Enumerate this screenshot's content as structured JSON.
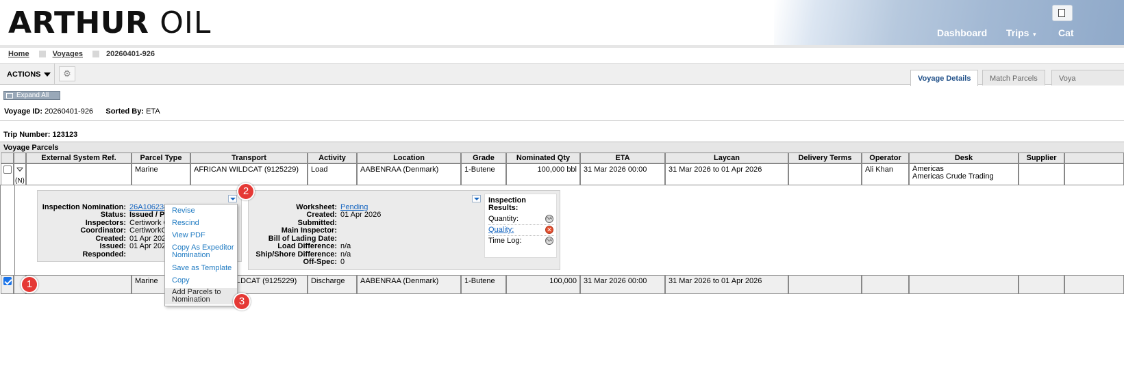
{
  "brand": {
    "logo_bold": "ARTHUR",
    "logo_thin": "OIL"
  },
  "nav": {
    "dashboard": "Dashboard",
    "trips": "Trips",
    "cat": "Cat"
  },
  "breadcrumb": {
    "home": "Home",
    "voyages": "Voyages",
    "current": "20260401-926"
  },
  "toolbar": {
    "actions": "ACTIONS",
    "tabs": [
      "Voyage Details",
      "Match Parcels",
      "Voya"
    ]
  },
  "expand_all": "Expand All",
  "voyage": {
    "id_label": "Voyage ID:",
    "id": "20260401-926",
    "sorted_label": "Sorted By:",
    "sorted": "ETA",
    "trip_label": "Trip Number:",
    "trip": "123123"
  },
  "parcels": {
    "title": "Voyage Parcels",
    "headers": [
      "External System Ref.",
      "Parcel Type",
      "Transport",
      "Activity",
      "Location",
      "Grade",
      "Nominated Qty",
      "ETA",
      "Laycan",
      "Delivery Terms",
      "Operator",
      "Desk",
      "Supplier"
    ],
    "row1": {
      "n": "(N)",
      "type": "Marine",
      "transport": "AFRICAN WILDCAT (9125229)",
      "activity": "Load",
      "location": "AABENRAA (Denmark)",
      "grade": "1-Butene",
      "qty": "100,000 bbl",
      "eta": "31 Mar 2026 00:00",
      "laycan": "31 Mar 2026 to 01 Apr 2026",
      "operator": "Ali Khan",
      "desk1": "Americas",
      "desk2": "Americas Crude Trading"
    },
    "row2": {
      "type": "Marine",
      "transport": "LDCAT (9125229)",
      "activity": "Discharge",
      "location": "AABENRAA (Denmark)",
      "grade": "1-Butene",
      "qty": "100,000",
      "eta": "31 Mar 2026 00:00",
      "laycan": "31 Mar 2026 to 01 Apr 2026"
    }
  },
  "nomination": {
    "labels": [
      "Inspection Nomination:",
      "Status:",
      "Inspectors:",
      "Coordinator:",
      "Created:",
      "Issued:",
      "Responded:"
    ],
    "link": "26A106234",
    "status": "Issued / P",
    "inspectors": "Certiwork C",
    "coordinator": "CertiworkC",
    "created": "01 Apr 202",
    "issued": "01 Apr 202"
  },
  "worksheet": {
    "labels": [
      "Worksheet:",
      "Created:",
      "Submitted:",
      "Main Inspector:",
      "Bill of Lading Date:",
      "Load Difference:",
      "Ship/Shore Difference:",
      "Off-Spec:"
    ],
    "status": "Pending",
    "created": "01 Apr 2026",
    "load_diff": "n/a",
    "ship_shore": "n/a",
    "offspec": "0"
  },
  "results": {
    "title": "Inspection Results:",
    "quantity": "Quantity:",
    "quality": "Quality:",
    "timelog": "Time Log:",
    "na": "NA",
    "x": "✕"
  },
  "menu": [
    "Revise",
    "Rescind",
    "View PDF",
    "Copy As Expeditor",
    "Nomination",
    "Save as Template",
    "Copy",
    "Add Parcels to",
    "Nomination"
  ],
  "badges": [
    "1",
    "2",
    "3"
  ],
  "icons": {
    "wrench": "wrench-icon"
  }
}
